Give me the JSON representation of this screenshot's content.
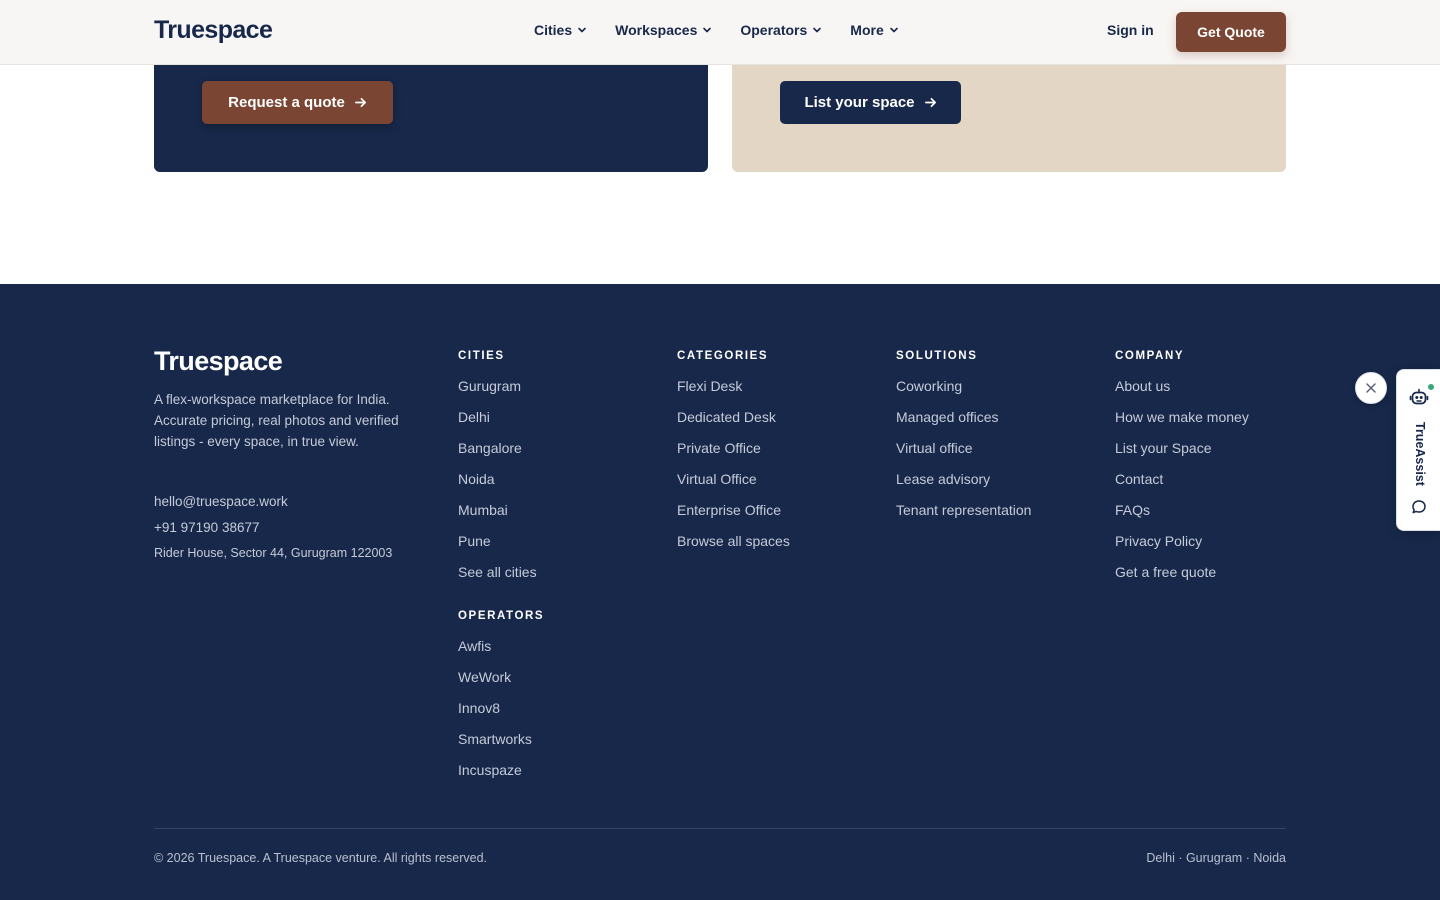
{
  "header": {
    "logo": "Truespace",
    "nav": [
      {
        "label": "Cities"
      },
      {
        "label": "Workspaces"
      },
      {
        "label": "Operators"
      },
      {
        "label": "More"
      }
    ],
    "sign_in": "Sign in",
    "get_quote": "Get Quote"
  },
  "cta": {
    "request_quote": "Request a quote",
    "list_space": "List your space"
  },
  "footer": {
    "logo": "Truespace",
    "description": "A flex-workspace marketplace for India. Accurate pricing, real photos and verified listings - every space, in true view.",
    "email": "hello@truespace.work",
    "phone": "+91 97190 38677",
    "address": "Rider House, Sector 44, Gurugram 122003",
    "cities": {
      "heading": "CITIES",
      "links": [
        "Gurugram",
        "Delhi",
        "Bangalore",
        "Noida",
        "Mumbai",
        "Pune",
        "See all cities"
      ]
    },
    "operators": {
      "heading": "OPERATORS",
      "links": [
        "Awfis",
        "WeWork",
        "Innov8",
        "Smartworks",
        "Incuspaze"
      ]
    },
    "categories": {
      "heading": "CATEGORIES",
      "links": [
        "Flexi Desk",
        "Dedicated Desk",
        "Private Office",
        "Virtual Office",
        "Enterprise Office",
        "Browse all spaces"
      ]
    },
    "solutions": {
      "heading": "SOLUTIONS",
      "links": [
        "Coworking",
        "Managed offices",
        "Virtual office",
        "Lease advisory",
        "Tenant representation"
      ]
    },
    "company": {
      "heading": "COMPANY",
      "links": [
        "About us",
        "How we make money",
        "List your Space",
        "Contact",
        "FAQs",
        "Privacy Policy",
        "Get a free quote"
      ]
    },
    "copyright": "© 2026 Truespace. A Truespace venture. All rights reserved.",
    "city_list": "Delhi · Gurugram · Noida"
  },
  "assistant": {
    "label": "TrueAssist",
    "icons": [
      "close-icon",
      "robot-icon",
      "chat-bubble-icon"
    ]
  },
  "colors": {
    "navy": "#17284a",
    "brown": "#7a4532",
    "beige": "#e4d6c4",
    "header_bg": "#f8f6f4",
    "status_online": "#3aa876"
  }
}
